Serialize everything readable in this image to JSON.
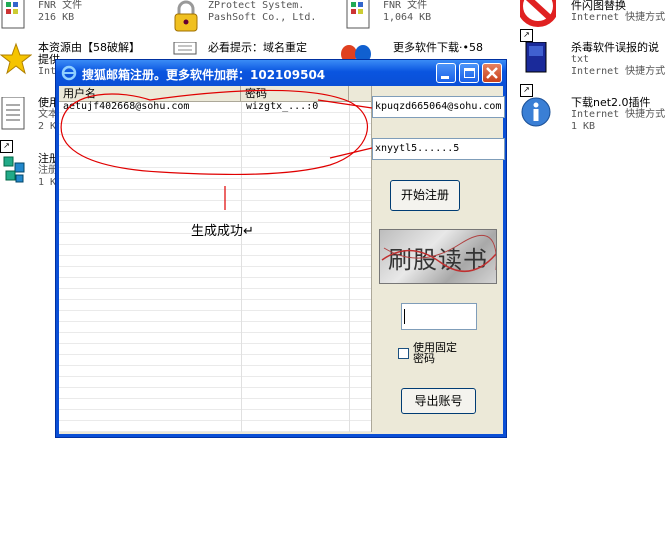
{
  "desktop": {
    "items": [
      {
        "label": "",
        "sub": "FNR 文件",
        "sub2": "216 KB",
        "icon": "document-icon"
      },
      {
        "label": "ZProtect System.",
        "sub": "PashSoft Co., Ltd.",
        "sub2": "",
        "icon": "lock-icon"
      },
      {
        "label": "",
        "sub": "FNR 文件",
        "sub2": "1,064 KB",
        "icon": "document-icon"
      },
      {
        "label": "件闪图替换",
        "sub": "Internet 快捷方式",
        "sub2": "",
        "icon": "no-entry-icon"
      },
      {
        "label": "本资源由【58破解】",
        "sub": "提供",
        "sub2": "Inte",
        "icon": "star-icon"
      },
      {
        "label": "必看提示：域名重定",
        "sub": "",
        "sub2": "",
        "icon": "notepad-icon"
      },
      {
        "label": "更多软件下载·•58",
        "sub": "",
        "sub2": "",
        "icon": "butterfly-icon"
      },
      {
        "label": "杀毒软件误报的说",
        "sub": "txt",
        "sub2": "Internet 快捷方式",
        "icon": "book-icon"
      },
      {
        "label": "使用",
        "sub": "文本",
        "sub2": "2 K",
        "icon": "text-file-icon"
      },
      {
        "label": "下载net2.0插件",
        "sub": "Internet 快捷方式",
        "sub2": "1 KB",
        "icon": "info-icon"
      },
      {
        "label": "注册",
        "sub": "注册",
        "sub2": "1 K",
        "icon": "registry-icon"
      }
    ]
  },
  "window": {
    "title": "搜狐邮箱注册。更多软件加群：102109504",
    "columns": [
      "用户名",
      "密码"
    ],
    "rows": [
      {
        "username": "aetujf402668@sohu.com",
        "password": "wizgtx_...:0"
      }
    ],
    "email_value": "kpuqzd665064@sohu.com",
    "password_value": "xnyytl5......5",
    "register_button": "开始注册",
    "captcha_text": "刷股读书",
    "captcha_input": "",
    "fixed_password_label": "使用固定密码",
    "fixed_password_checked": false,
    "export_button": "导出账号"
  },
  "annotation": {
    "note": "生成成功↵"
  },
  "colors": {
    "titlebar": "#0a4fd6",
    "annotation_red": "#e00000"
  }
}
